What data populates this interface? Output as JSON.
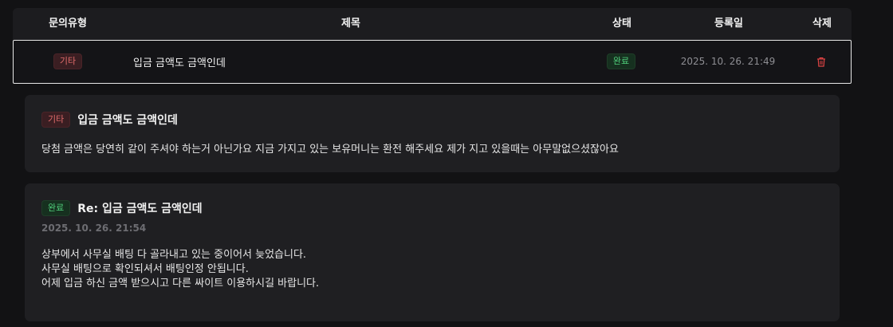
{
  "table": {
    "headers": {
      "type": "문의유형",
      "title": "제목",
      "status": "상태",
      "date": "등록일",
      "delete": "삭제"
    },
    "rows": [
      {
        "type": "기타",
        "title": "입금 금액도 금액인데",
        "status": "완료",
        "date": "2025. 10. 26. 21:49",
        "delete_icon": "trash-icon"
      }
    ]
  },
  "inquiry": {
    "type_badge": "기타",
    "title": "입금 금액도 금액인데",
    "content": "당첨 금액은 당연히 같이 주셔야 하는거 아닌가요 지금 가지고 있는 보유머니는 환전 해주세요 제가 지고 있을때는 아무말없으셨잖아요"
  },
  "answer": {
    "status_badge": "완료",
    "title": "Re: 입금 금액도 금액인데",
    "date": "2025. 10. 26. 21:54",
    "lines": [
      "상부에서 사무실 배팅 다 골라내고 있는 중이어서 늦었습니다.",
      "사무실 배팅으로 확인되셔서 배팅인정 안됩니다.",
      "어제 입금 하신 금액 받으시고 다른 싸이트 이용하시길 바랍니다."
    ]
  },
  "colors": {
    "background": "#121214",
    "card": "#1f1f22",
    "badge_red": "#e06b6b",
    "badge_green": "#4fcf7b",
    "delete_icon": "#e04444"
  }
}
